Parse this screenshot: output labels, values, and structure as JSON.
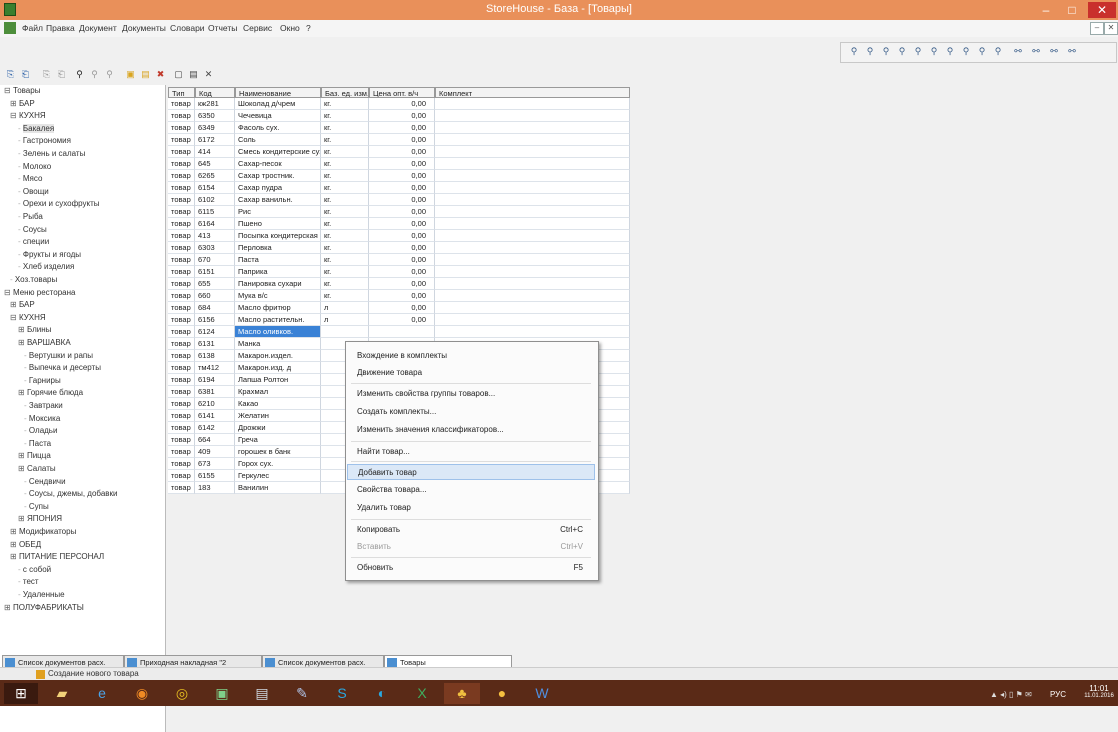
{
  "window": {
    "title": "StoreHouse - База - [Товары]",
    "minimize": "–",
    "maximize": "□",
    "close": "✕"
  },
  "menu": [
    "Файл",
    "Правка",
    "Документ",
    "Документы",
    "Словари",
    "Отчеты",
    "Сервис",
    "Окно",
    "?"
  ],
  "mdi_buttons": [
    "–",
    "✕"
  ],
  "grid": {
    "headers": [
      "Тип",
      "Код",
      "Наименование",
      "Баз. ед. изм.",
      "Цена опт. в/ч",
      "Комплект"
    ],
    "rows": [
      [
        "товар",
        "кж281",
        "Шоколад д/чрем",
        "кг.",
        "0,00"
      ],
      [
        "товар",
        "6350",
        "Чечевица",
        "кг.",
        "0,00"
      ],
      [
        "товар",
        "6349",
        "Фасоль сух.",
        "кг.",
        "0,00"
      ],
      [
        "товар",
        "6172",
        "Соль",
        "кг.",
        "0,00"
      ],
      [
        "товар",
        "414",
        "Смесь кондитерские сухие",
        "кг.",
        "0,00"
      ],
      [
        "товар",
        "645",
        "Сахар-песок",
        "кг.",
        "0,00"
      ],
      [
        "товар",
        "6265",
        "Сахар тростник.",
        "кг.",
        "0,00"
      ],
      [
        "товар",
        "6154",
        "Сахар пудра",
        "кг.",
        "0,00"
      ],
      [
        "товар",
        "6102",
        "Сахар ванильн.",
        "кг.",
        "0,00"
      ],
      [
        "товар",
        "6115",
        "Рис",
        "кг.",
        "0,00"
      ],
      [
        "товар",
        "6164",
        "Пшено",
        "кг.",
        "0,00"
      ],
      [
        "товар",
        "413",
        "Посыпка кондитерская",
        "кг.",
        "0,00"
      ],
      [
        "товар",
        "6303",
        "Перловка",
        "кг.",
        "0,00"
      ],
      [
        "товар",
        "670",
        "Паста",
        "кг.",
        "0,00"
      ],
      [
        "товар",
        "6151",
        "Паприка",
        "кг.",
        "0,00"
      ],
      [
        "товар",
        "655",
        "Панировка сухари",
        "кг.",
        "0,00"
      ],
      [
        "товар",
        "660",
        "Мука в/с",
        "кг.",
        "0,00"
      ],
      [
        "товар",
        "684",
        "Масло фритюр",
        "л",
        "0,00"
      ],
      [
        "товар",
        "6156",
        "Масло растительн.",
        "л",
        "0,00"
      ],
      [
        "товар",
        "6124",
        "Масло оливков.",
        "",
        ""
      ],
      [
        "товар",
        "6131",
        "Манка",
        "",
        ""
      ],
      [
        "товар",
        "6138",
        "Макарон.издел.",
        "",
        ""
      ],
      [
        "товар",
        "тм412",
        "Макарон.изд. д",
        "",
        ""
      ],
      [
        "товар",
        "6194",
        "Лапша Ролтон",
        "",
        ""
      ],
      [
        "товар",
        "6381",
        "Крахмал",
        "",
        ""
      ],
      [
        "товар",
        "6210",
        "Какао",
        "",
        ""
      ],
      [
        "товар",
        "6141",
        "Желатин",
        "",
        ""
      ],
      [
        "товар",
        "6142",
        "Дрожжи",
        "",
        ""
      ],
      [
        "товар",
        "664",
        "Греча",
        "",
        ""
      ],
      [
        "товар",
        "409",
        "горошек в банк",
        "",
        ""
      ],
      [
        "товар",
        "673",
        "Горох сух.",
        "",
        ""
      ],
      [
        "товар",
        "6155",
        "Геркулес",
        "",
        ""
      ],
      [
        "товар",
        "183",
        "Ванилин",
        "",
        ""
      ]
    ]
  },
  "tree": [
    "Товары",
    "БАР",
    "КУХНЯ",
    "Бакалея",
    "Гастрономия",
    "Зелень и салаты",
    "Молоко",
    "Мясо",
    "Овощи",
    "Орехи и сухофрукты",
    "Рыба",
    "Соусы",
    "специи",
    "Фрукты и ягоды",
    "Хлеб изделия",
    "Хоз.товары",
    "Меню ресторана",
    "БАР",
    "КУХНЯ",
    "Блины",
    "ВАРШАВКА",
    "Вертушки и рапы",
    "Выпечка и десерты",
    "Гарниры",
    "Горячие блюда",
    "Завтраки",
    "Моксика",
    "Оладьи",
    "Паста",
    "Пицца",
    "Салаты",
    "Сендвичи",
    "Соусы, джемы, добавки",
    "Супы",
    "ЯПОНИЯ",
    "Модификаторы",
    "ОБЕД",
    "ПИТАНИЕ ПЕРСОНАЛ",
    "с собой",
    "тест",
    "Удаленные",
    "ПОЛУФАБРИКАТЫ"
  ],
  "context_menu": [
    {
      "label": "Вхождение в комплекты",
      "shortcut": ""
    },
    {
      "label": "Движение товара",
      "shortcut": ""
    },
    {
      "label": "Изменить свойства группы товаров...",
      "shortcut": ""
    },
    {
      "label": "Создать комплекты...",
      "shortcut": ""
    },
    {
      "label": "Изменить значения классификаторов...",
      "shortcut": ""
    },
    {
      "label": "Найти товар...",
      "shortcut": ""
    },
    {
      "label": "Добавить товар",
      "shortcut": ""
    },
    {
      "label": "Свойства товара...",
      "shortcut": ""
    },
    {
      "label": "Удалить товар",
      "shortcut": ""
    },
    {
      "label": "Копировать",
      "shortcut": "Ctrl+C"
    },
    {
      "label": "Вставить",
      "shortcut": "Ctrl+V"
    },
    {
      "label": "Обновить",
      "shortcut": "F5"
    }
  ],
  "tabs": [
    "Список документов расх.",
    "Приходная накладная \"2",
    "Список документов расх.",
    "Товары"
  ],
  "status_text": "Создание нового товара",
  "tray": {
    "lang": "РУС",
    "time": "11:01",
    "date": "11.01.2016"
  },
  "colors": {
    "title_bar": "#e9905a",
    "selection": "#3a82d6",
    "taskbar": "#5a2a17",
    "close_button": "#c9302c"
  }
}
